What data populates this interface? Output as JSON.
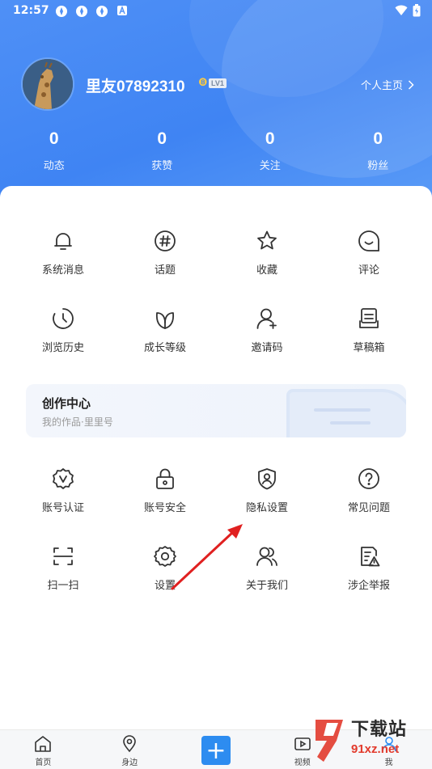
{
  "status_bar": {
    "time": "12:57",
    "icons": [
      "app-icon",
      "app-icon",
      "app-icon",
      "a-icon"
    ],
    "right_icons": [
      "wifi-icon",
      "battery-icon"
    ]
  },
  "profile": {
    "username": "里友07892310",
    "level": "LV1",
    "homepage_label": "个人主页"
  },
  "stats": [
    {
      "value": "0",
      "label": "动态"
    },
    {
      "value": "0",
      "label": "获赞"
    },
    {
      "value": "0",
      "label": "关注"
    },
    {
      "value": "0",
      "label": "粉丝"
    }
  ],
  "grid_top": [
    {
      "label": "系统消息",
      "icon": "bell-icon"
    },
    {
      "label": "话题",
      "icon": "hashtag-icon"
    },
    {
      "label": "收藏",
      "icon": "star-icon"
    },
    {
      "label": "评论",
      "icon": "comment-icon"
    },
    {
      "label": "浏览历史",
      "icon": "history-icon"
    },
    {
      "label": "成长等级",
      "icon": "leaf-icon"
    },
    {
      "label": "邀请码",
      "icon": "add-user-icon"
    },
    {
      "label": "草稿箱",
      "icon": "drafts-icon"
    }
  ],
  "creator": {
    "title": "创作中心",
    "subtitle": "我的作品·里里号"
  },
  "grid_bottom": [
    {
      "label": "账号认证",
      "icon": "verified-badge-icon"
    },
    {
      "label": "账号安全",
      "icon": "lock-icon"
    },
    {
      "label": "隐私设置",
      "icon": "shield-user-icon"
    },
    {
      "label": "常见问题",
      "icon": "question-icon"
    },
    {
      "label": "扫一扫",
      "icon": "scan-icon"
    },
    {
      "label": "设置",
      "icon": "gear-icon"
    },
    {
      "label": "关于我们",
      "icon": "users-icon"
    },
    {
      "label": "涉企举报",
      "icon": "report-icon"
    }
  ],
  "tabbar": [
    {
      "label": "首页",
      "icon": "home-icon"
    },
    {
      "label": "身边",
      "icon": "location-icon"
    },
    {
      "label": "",
      "icon": "plus-icon"
    },
    {
      "label": "视频",
      "icon": "video-icon"
    },
    {
      "label": "我",
      "icon": "profile-icon"
    }
  ],
  "watermark": {
    "title": "下载站",
    "domain": "91xz.net"
  },
  "colors": {
    "accent": "#2d8cf0",
    "hero": "#4589f5",
    "arrow": "#e02020"
  }
}
